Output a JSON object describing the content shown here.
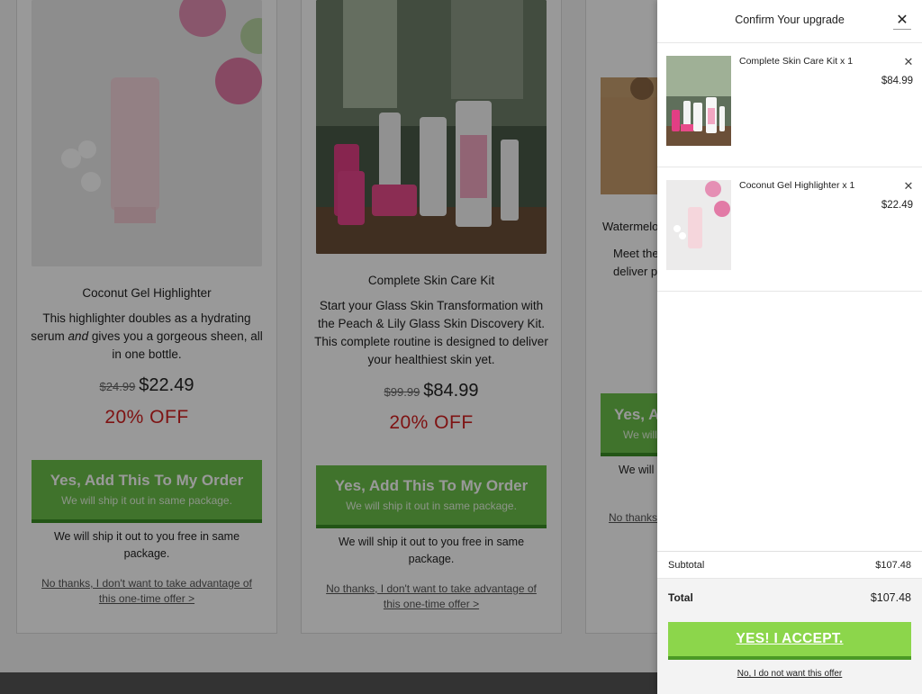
{
  "cards": [
    {
      "title": "Coconut Gel Highlighter",
      "desc_line1": "This highlighter doubles as a hydrating",
      "desc_line2_em": "and",
      "desc_line2_a": "serum",
      "desc_line2_b": "gives you a gorgeous sheen, all",
      "desc_line3": "in one bottle.",
      "old_price": "$24.99",
      "price": "$22.49",
      "off": "20% OFF",
      "btn_main": "Yes, Add This To My Order",
      "btn_sub": "We will ship it out in same package.",
      "free_text": "We will ship it out to you free in same package.",
      "no_thanks": "No thanks, I don't want to take advantage of this one-time offer >"
    },
    {
      "title": "Complete Skin Care Kit",
      "desc": "Start your Glass Skin Transformation with the Peach & Lily Glass Skin Discovery Kit. This complete routine is designed to deliver your healthiest skin yet.",
      "old_price": "$99.99",
      "price": "$84.99",
      "off": "20% OFF",
      "btn_main": "Yes, Add This To My Order",
      "btn_sub": "We will ship it out in same package.",
      "free_text": "We will ship it out to you free in same package.",
      "no_thanks": "No thanks, I don't want to take advantage of this one-time offer >"
    },
    {
      "title": "Watermelo",
      "desc_line1": "Meet the",
      "desc_line2": "deliver pl",
      "btn_main": "Yes, A",
      "btn_sub": "We will",
      "free_text": "We will",
      "no_thanks": "No thanks"
    }
  ],
  "drawer": {
    "title": "Confirm Your upgrade",
    "close_glyph": "✕",
    "items": [
      {
        "name": "Complete Skin Care Kit x 1",
        "price": "$84.99",
        "remove_glyph": "✕"
      },
      {
        "name": "Coconut Gel Highlighter x 1",
        "price": "$22.49",
        "remove_glyph": "✕"
      }
    ],
    "subtotal_label": "Subtotal",
    "subtotal_value": "$107.48",
    "total_label": "Total",
    "total_value": "$107.48",
    "accept_label": "YES! I ACCEPT.",
    "decline_label": "No, I do not want this offer"
  },
  "colors": {
    "accept_green": "#8cd64b",
    "card_btn_green": "#6cc04a",
    "off_red": "#d32020"
  }
}
